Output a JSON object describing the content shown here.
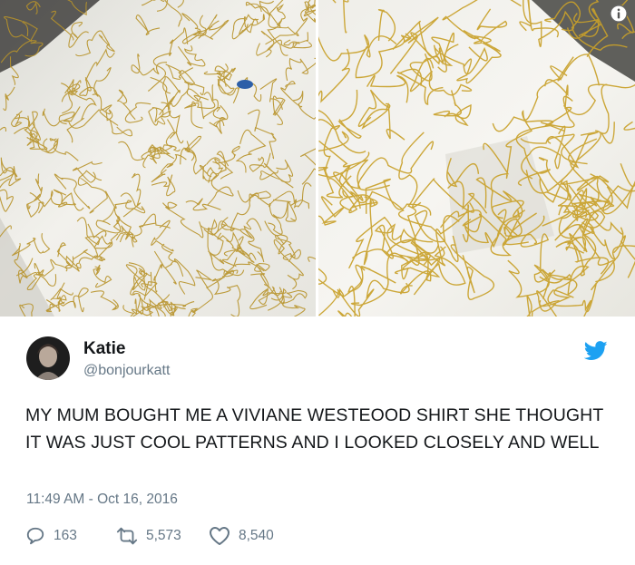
{
  "images": {
    "left_alt": "shirt-photo-left",
    "right_alt": "shirt-photo-right",
    "info_icon": "info-icon"
  },
  "tweet": {
    "author_name": "Katie",
    "author_handle": "@bonjourkatt",
    "text": "MY MUM BOUGHT ME A VIVIANE WESTEOOD SHIRT SHE THOUGHT IT WAS JUST COOL PATTERNS AND I LOOKED CLOSELY AND WELL",
    "timestamp": "11:49 AM - Oct 16, 2016",
    "replies": "163",
    "retweets": "5,573",
    "likes": "8,540"
  },
  "icons": {
    "brand": "twitter-bird-icon",
    "reply": "reply-icon",
    "retweet": "retweet-icon",
    "like": "heart-icon"
  },
  "colors": {
    "brand": "#1da1f2",
    "name": "#14171a",
    "secondary": "#657786",
    "pattern_gold": "#c9a12a"
  }
}
